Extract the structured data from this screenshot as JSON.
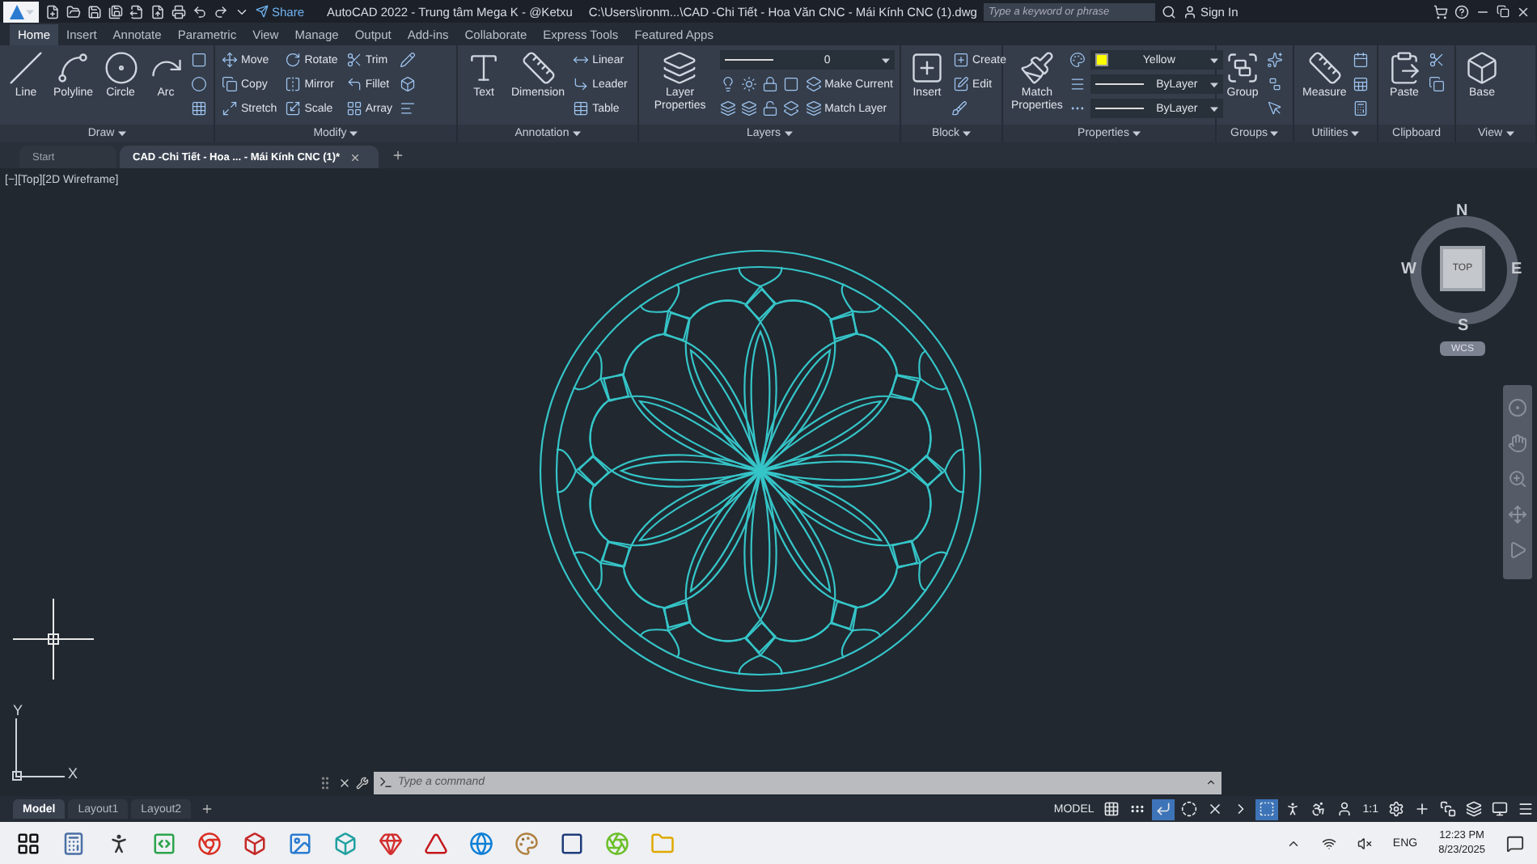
{
  "title_bar": {
    "share": "Share",
    "app_title": "AutoCAD 2022 - Trung tâm Mega K - @Ketxu",
    "file_path": "C:\\Users\\ironm...\\CAD -Chi Tiết - Hoa Văn CNC - Mái Kính  CNC (1).dwg",
    "search": {
      "placeholder": "Type a keyword or phrase"
    },
    "sign_in": "Sign In"
  },
  "ribbon_tabs": [
    {
      "label": "Home",
      "selected": true
    },
    {
      "label": "Insert",
      "selected": false
    },
    {
      "label": "Annotate",
      "selected": false
    },
    {
      "label": "Parametric",
      "selected": false
    },
    {
      "label": "View",
      "selected": false
    },
    {
      "label": "Manage",
      "selected": false
    },
    {
      "label": "Output",
      "selected": false
    },
    {
      "label": "Add-ins",
      "selected": false
    },
    {
      "label": "Collaborate",
      "selected": false
    },
    {
      "label": "Express Tools",
      "selected": false
    },
    {
      "label": "Featured Apps",
      "selected": false
    }
  ],
  "ribbon_panels": [
    {
      "title": "Draw",
      "expandable": true,
      "items": [
        {
          "kind": "large",
          "label": "Line"
        },
        {
          "kind": "large",
          "label": "Polyline"
        },
        {
          "kind": "large",
          "label": "Circle"
        },
        {
          "kind": "large",
          "label": "Arc"
        },
        {
          "kind": "stack",
          "rows": [
            [
              {
                "kind": "icon"
              }
            ],
            [
              {
                "kind": "icon"
              }
            ],
            [
              {
                "kind": "icon"
              }
            ]
          ]
        }
      ]
    },
    {
      "title": "Modify",
      "expandable": true,
      "items": [
        {
          "kind": "stack",
          "rows": [
            [
              {
                "kind": "small",
                "label": "Move"
              },
              {
                "kind": "small",
                "label": "Rotate"
              },
              {
                "kind": "small",
                "label": "Trim"
              },
              {
                "kind": "icon"
              }
            ],
            [
              {
                "kind": "small",
                "label": "Copy"
              },
              {
                "kind": "small",
                "label": "Mirror"
              },
              {
                "kind": "small",
                "label": "Fillet"
              },
              {
                "kind": "icon"
              }
            ],
            [
              {
                "kind": "small",
                "label": "Stretch"
              },
              {
                "kind": "small",
                "label": "Scale"
              },
              {
                "kind": "small",
                "label": "Array"
              },
              {
                "kind": "icon"
              }
            ]
          ]
        }
      ]
    },
    {
      "title": "Annotation",
      "expandable": true,
      "items": [
        {
          "kind": "large",
          "label": "Text"
        },
        {
          "kind": "large",
          "label": "Dimension"
        },
        {
          "kind": "stack",
          "rows": [
            [
              {
                "kind": "small",
                "label": "Linear"
              }
            ],
            [
              {
                "kind": "small",
                "label": "Leader"
              }
            ],
            [
              {
                "kind": "small",
                "label": "Table"
              }
            ]
          ]
        }
      ]
    },
    {
      "title": "Layers",
      "expandable": true,
      "items": [
        {
          "kind": "large",
          "label": "Layer Properties"
        },
        {
          "kind": "stack",
          "rows": [
            [
              {
                "kind": "dropdown",
                "value": "0"
              }
            ],
            [
              {
                "kind": "icon"
              },
              {
                "kind": "icon"
              },
              {
                "kind": "icon"
              },
              {
                "kind": "icon"
              },
              {
                "kind": "small",
                "label": "Make Current"
              }
            ],
            [
              {
                "kind": "icon"
              },
              {
                "kind": "icon"
              },
              {
                "kind": "icon"
              },
              {
                "kind": "icon"
              },
              {
                "kind": "small",
                "label": "Match Layer"
              }
            ]
          ]
        }
      ]
    },
    {
      "title": "Block",
      "expandable": true,
      "items": [
        {
          "kind": "large",
          "label": "Insert"
        },
        {
          "kind": "stack",
          "rows": [
            [
              {
                "kind": "small",
                "label": "Create"
              }
            ],
            [
              {
                "kind": "small",
                "label": "Edit"
              }
            ],
            [
              {
                "kind": "icon"
              }
            ]
          ]
        }
      ]
    },
    {
      "title": "Properties",
      "expandable": true,
      "items": [
        {
          "kind": "large",
          "label": "Match Properties"
        },
        {
          "kind": "stack",
          "rows": [
            [
              {
                "kind": "icon"
              },
              {
                "kind": "dropdown",
                "value": "Yellow",
                "color": "#ffff00"
              }
            ],
            [
              {
                "kind": "icon"
              },
              {
                "kind": "dropdown",
                "value": "ByLayer"
              }
            ],
            [
              {
                "kind": "icon"
              },
              {
                "kind": "dropdown",
                "value": "ByLayer"
              }
            ]
          ]
        }
      ]
    },
    {
      "title": "Groups",
      "expandable": true,
      "items": [
        {
          "kind": "large",
          "label": "Group"
        },
        {
          "kind": "stack",
          "rows": [
            [
              {
                "kind": "icon"
              }
            ],
            [
              {
                "kind": "icon"
              }
            ],
            [
              {
                "kind": "icon"
              }
            ]
          ]
        }
      ]
    },
    {
      "title": "Utilities",
      "expandable": true,
      "items": [
        {
          "kind": "large",
          "label": "Measure"
        },
        {
          "kind": "stack",
          "rows": [
            [
              {
                "kind": "icon"
              }
            ],
            [
              {
                "kind": "icon"
              }
            ],
            [
              {
                "kind": "icon"
              }
            ]
          ]
        }
      ]
    },
    {
      "title": "Clipboard",
      "expandable": false,
      "items": [
        {
          "kind": "large",
          "label": "Paste"
        },
        {
          "kind": "stack",
          "rows": [
            [
              {
                "kind": "icon"
              }
            ],
            [
              {
                "kind": "icon"
              }
            ]
          ]
        }
      ]
    },
    {
      "title": "View",
      "expandable": true,
      "items": [
        {
          "kind": "large",
          "label": "Base"
        }
      ]
    }
  ],
  "file_tabs": [
    {
      "label": "Start",
      "selected": false
    },
    {
      "label": "CAD -Chi Tiết - Hoa ... - Mái Kính  CNC (1)*",
      "selected": true
    }
  ],
  "viewport": {
    "label": "[−][Top][2D Wireframe]",
    "viewcube": {
      "north": "N",
      "east": "E",
      "south": "S",
      "west": "W",
      "face": "TOP",
      "ucs": "WCS"
    },
    "ucs_x": "X",
    "ucs_y": "Y"
  },
  "command_line": {
    "placeholder": "Type a command"
  },
  "layout_tabs": [
    {
      "label": "Model",
      "selected": true
    },
    {
      "label": "Layout1",
      "selected": false
    },
    {
      "label": "Layout2",
      "selected": false
    }
  ],
  "status_bar": {
    "space": "MODEL",
    "scale": "1:1",
    "toggles": [
      {
        "on": false
      },
      {
        "on": false
      },
      {
        "on": true
      },
      {
        "on": false
      },
      {
        "on": false
      },
      {
        "on": false
      },
      {
        "on": true
      }
    ]
  },
  "taskbar": {
    "language": "ENG",
    "time": "12:23 PM",
    "date": "8/23/2025"
  }
}
